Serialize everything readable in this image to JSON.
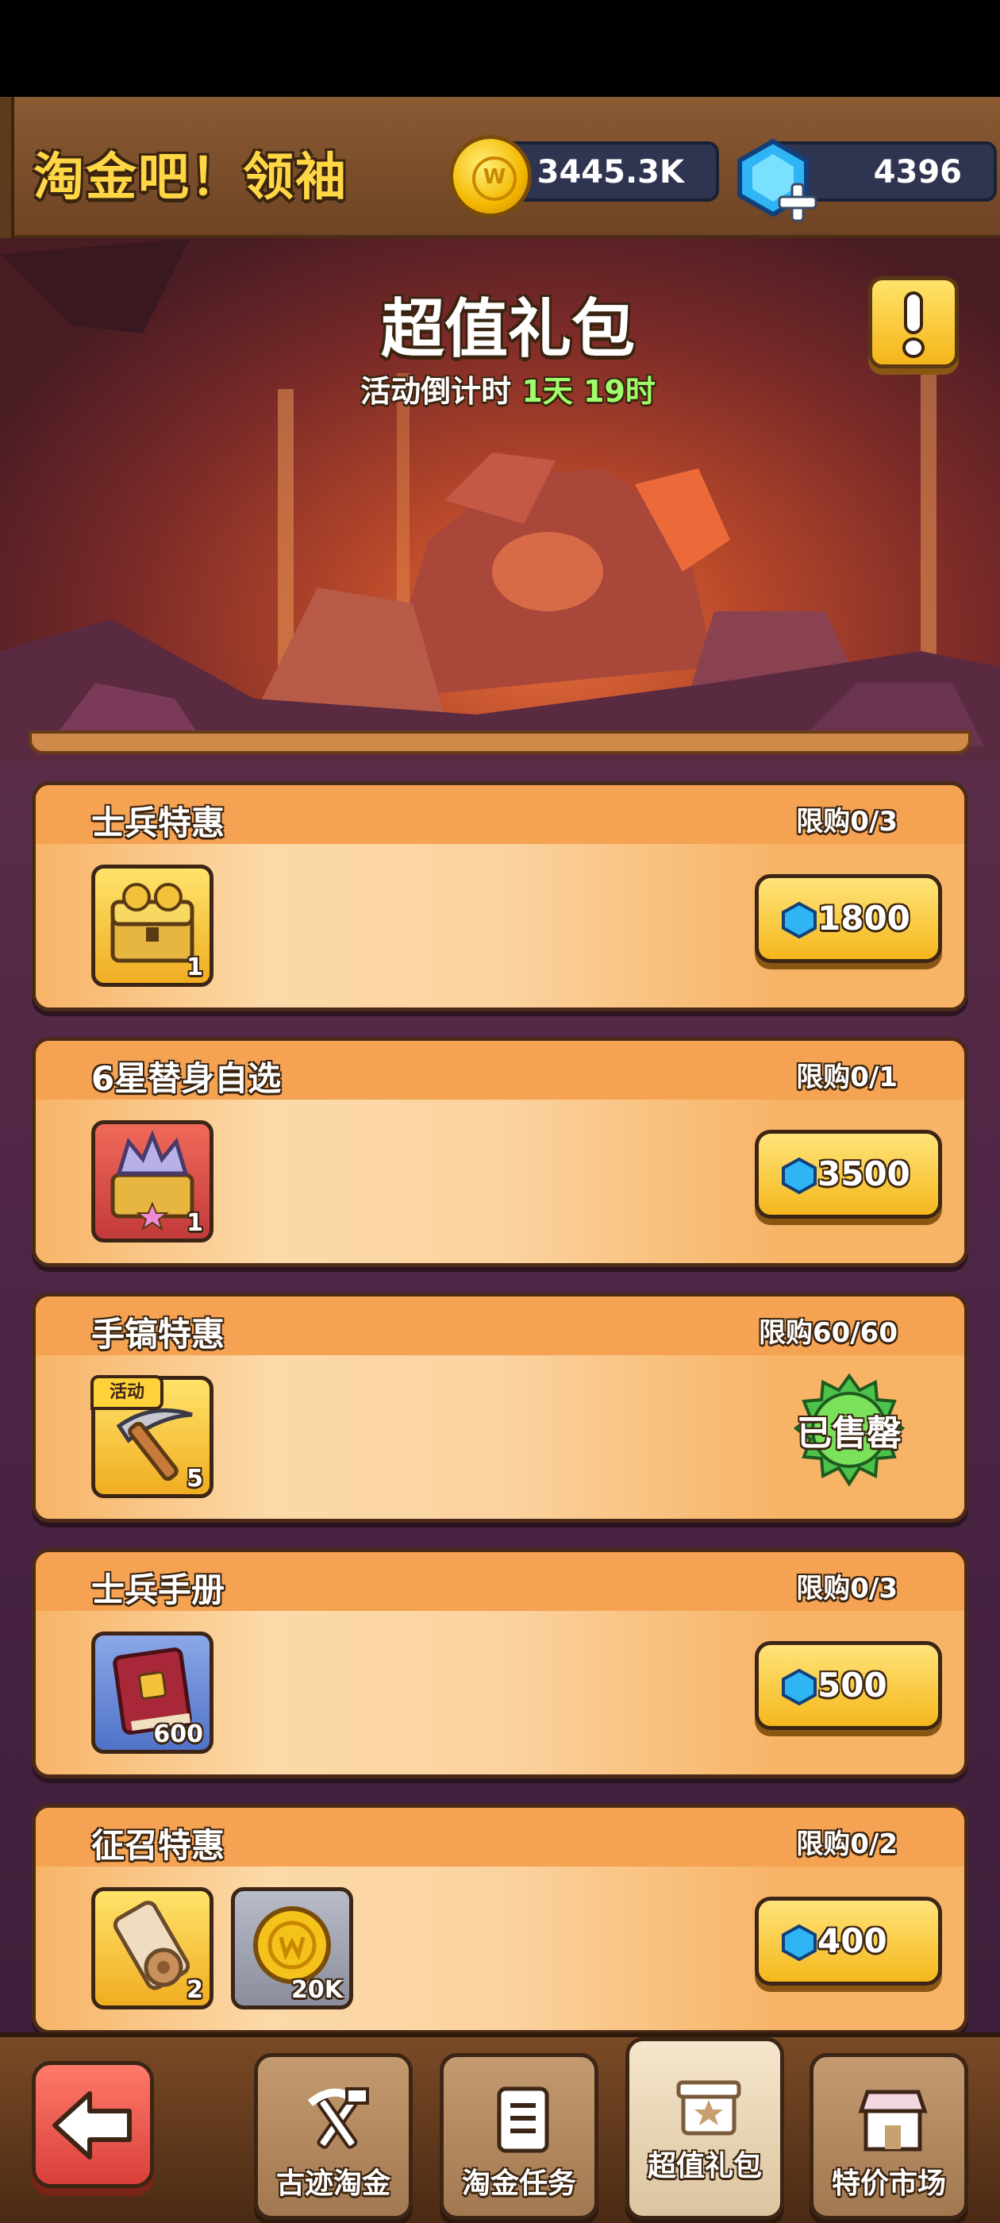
{
  "header": {
    "title": "淘金吧！领袖",
    "gold": "3445.3K",
    "gems": "4396"
  },
  "banner": {
    "title": "超值礼包",
    "countdown_label": "活动倒计时",
    "countdown_value": "1天 19时"
  },
  "packs": [
    {
      "name": "士兵特惠",
      "limit": "限购0/3",
      "price": "1800",
      "items": [
        {
          "icon": "treasure-chest-icon",
          "qty": "1"
        }
      ]
    },
    {
      "name": "6星替身自选",
      "limit": "限购0/1",
      "price": "3500",
      "items": [
        {
          "icon": "star-chest-icon",
          "qty": "1"
        }
      ]
    },
    {
      "name": "手镐特惠",
      "limit": "限购60/60",
      "sold_out": "已售罄",
      "items": [
        {
          "icon": "pickaxe-icon",
          "qty": "5",
          "tag": "活动"
        }
      ]
    },
    {
      "name": "士兵手册",
      "limit": "限购0/3",
      "price": "500",
      "items": [
        {
          "icon": "book-icon",
          "qty": "600"
        }
      ]
    },
    {
      "name": "征召特惠",
      "limit": "限购0/2",
      "price": "400",
      "items": [
        {
          "icon": "scroll-icon",
          "qty": "2"
        },
        {
          "icon": "coin-icon",
          "qty": "20K"
        }
      ]
    }
  ],
  "nav": {
    "tabs": [
      {
        "label": "古迹淘金",
        "icon": "pickaxe-hammer-icon"
      },
      {
        "label": "淘金任务",
        "icon": "clipboard-icon"
      },
      {
        "label": "超值礼包",
        "icon": "gift-box-icon",
        "active": true
      },
      {
        "label": "特价市场",
        "icon": "shop-icon"
      }
    ]
  },
  "colors": {
    "gold_text": "#ffd644",
    "countdown_green": "#9eff6a",
    "pack_bg": "#f7b567",
    "button_yellow": "#f5b71c"
  }
}
